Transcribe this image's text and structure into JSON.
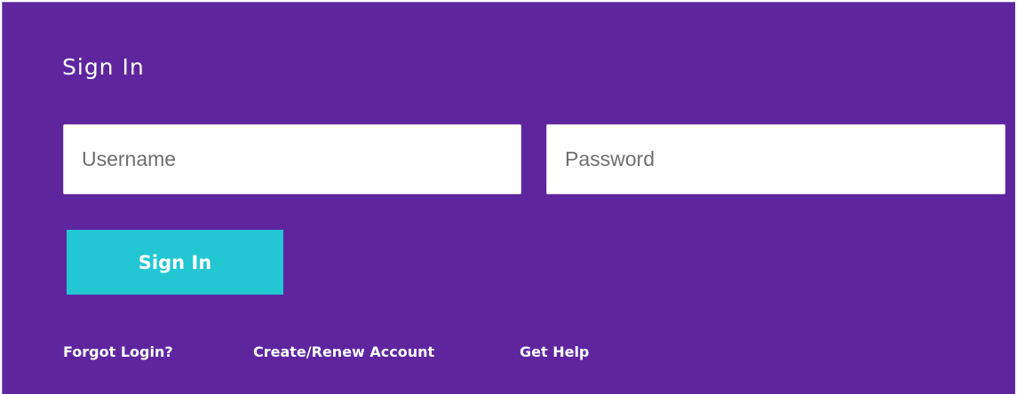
{
  "signin": {
    "title": "Sign In",
    "username_placeholder": "Username",
    "username_value": "",
    "password_placeholder": "Password",
    "password_value": "",
    "submit_label": "Sign In"
  },
  "links": {
    "forgot": "Forgot Login?",
    "create": "Create/Renew Account",
    "help": "Get Help"
  },
  "colors": {
    "background": "#5f259f",
    "button": "#22c7d3",
    "text": "#ffffff"
  }
}
